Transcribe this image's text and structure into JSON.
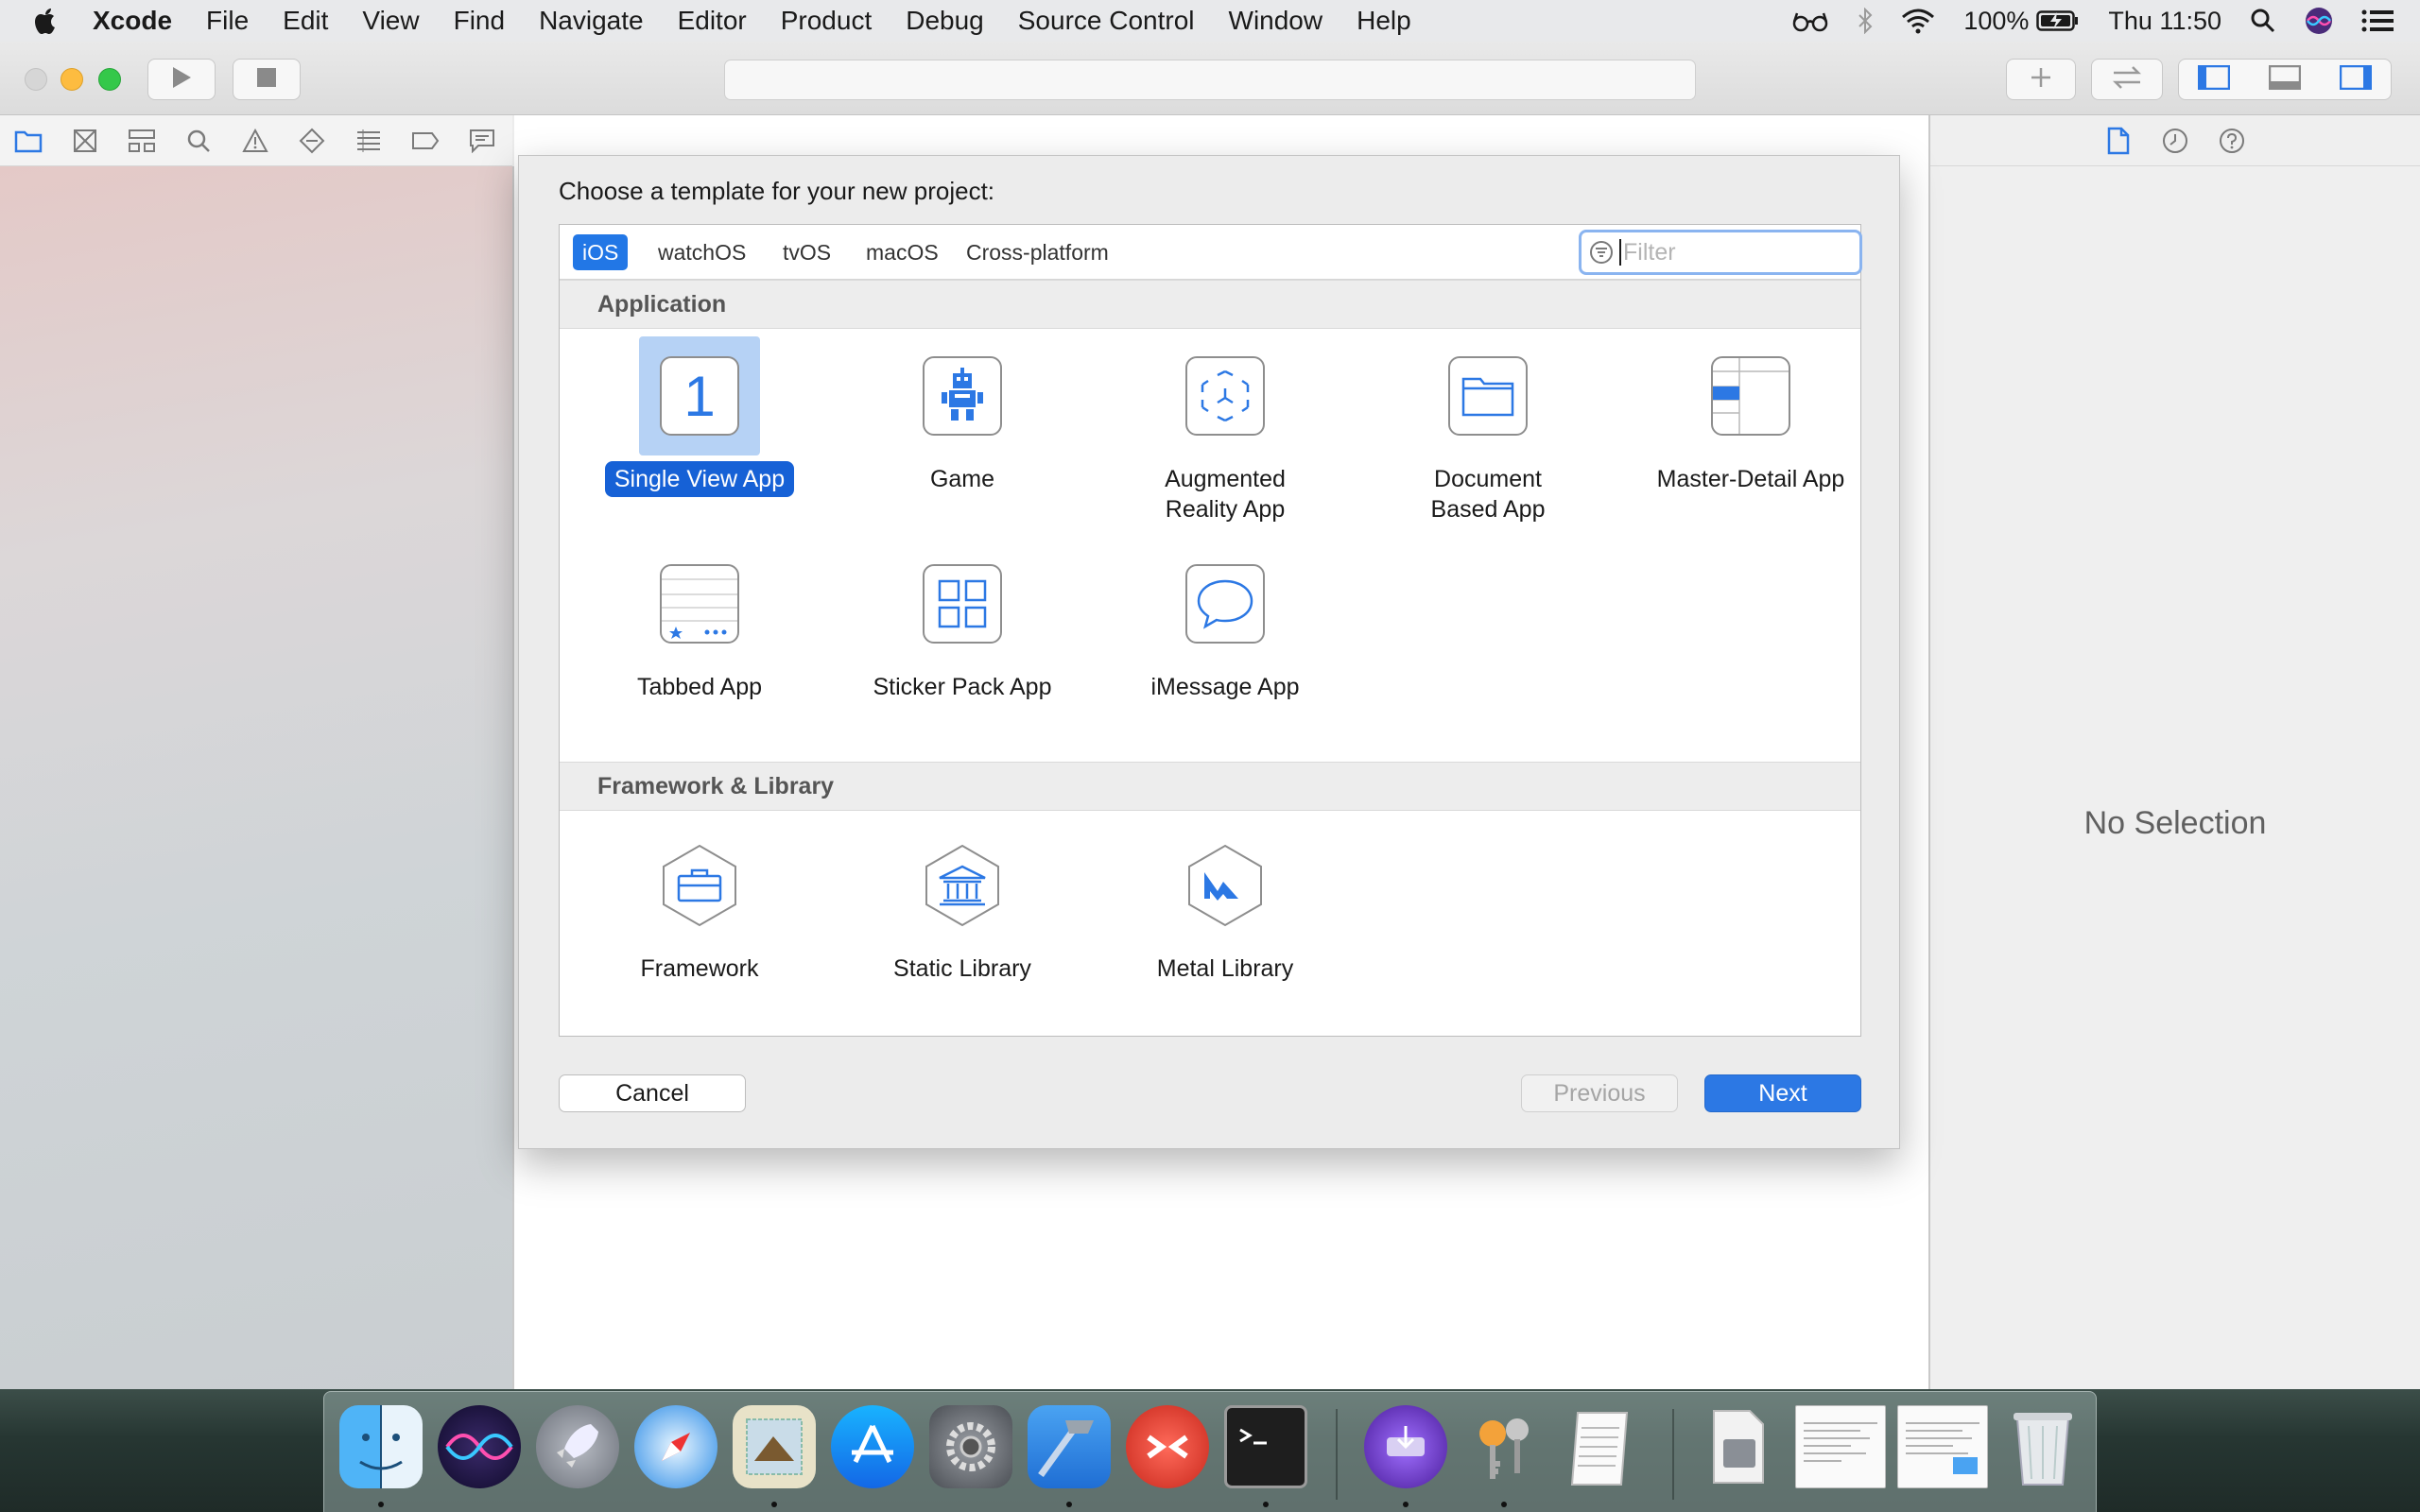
{
  "menubar": {
    "app_name": "Xcode",
    "items": [
      "File",
      "Edit",
      "View",
      "Find",
      "Navigate",
      "Editor",
      "Product",
      "Debug",
      "Source Control",
      "Window",
      "Help"
    ],
    "battery": "100%",
    "clock": "Thu 11:50"
  },
  "inspector": {
    "empty_text": "No Selection"
  },
  "dialog": {
    "title": "Choose a template for your new project:",
    "platforms": [
      "iOS",
      "watchOS",
      "tvOS",
      "macOS",
      "Cross-platform"
    ],
    "selected_platform": "iOS",
    "filter": {
      "placeholder": "Filter",
      "value": ""
    },
    "sections": [
      {
        "title": "Application",
        "templates": [
          "Single View App",
          "Game",
          "Augmented\nReality App",
          "Document\nBased App",
          "Master-Detail App",
          "Tabbed App",
          "Sticker Pack App",
          "iMessage App"
        ]
      },
      {
        "title": "Framework & Library",
        "templates": [
          "Framework",
          "Static Library",
          "Metal Library"
        ]
      }
    ],
    "selected_template": "Single View App",
    "buttons": {
      "cancel": "Cancel",
      "previous": "Previous",
      "next": "Next"
    }
  },
  "dock": {
    "apps": [
      "Finder",
      "Siri",
      "Launchpad",
      "Safari",
      "Mail",
      "App Store",
      "System Preferences",
      "Xcode",
      "Remote Desktop",
      "Terminal",
      "Disk Utility",
      "Keychain Access",
      "TextEdit",
      "Documents",
      "Screenshot",
      "Screenshot",
      "Trash"
    ]
  },
  "colors": {
    "accent": "#2c78e4",
    "selection": "#1661d6",
    "menubar": "#e8e9eb"
  }
}
